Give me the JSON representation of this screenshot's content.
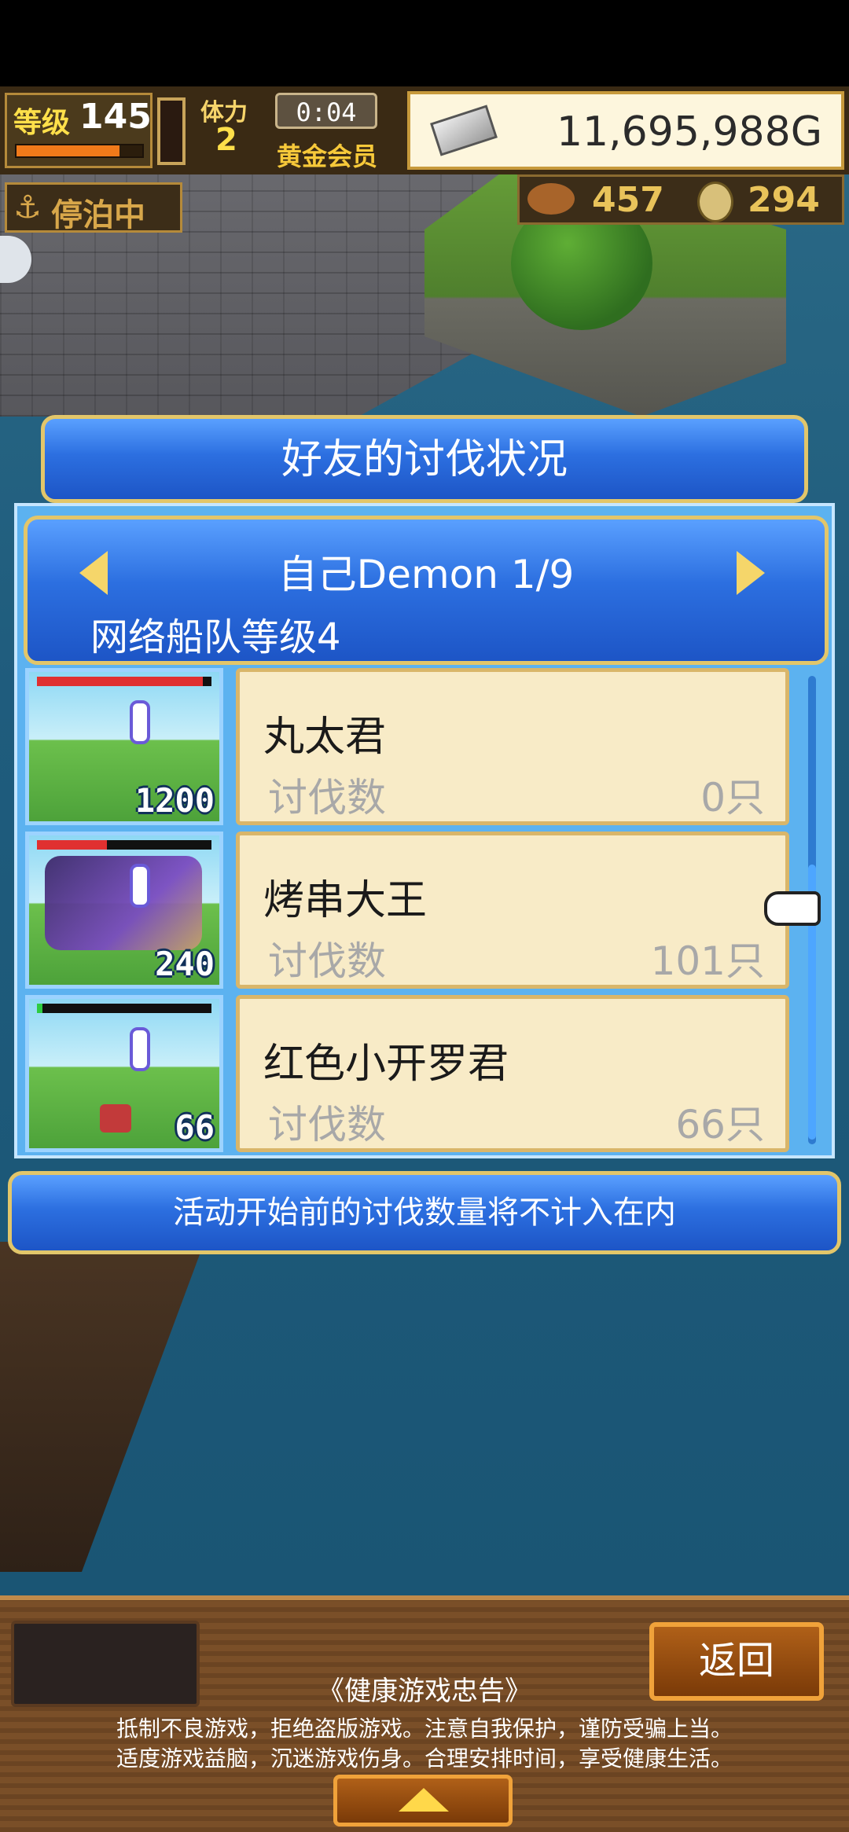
{
  "hud": {
    "level_label": "等级",
    "level_value": "145",
    "exp_progress": 0.82,
    "stamina_label": "体力",
    "stamina_value": "2",
    "timer": "0:04",
    "membership": "黄金会员",
    "money": "11,695,988G",
    "status": "停泊中",
    "meat": "457",
    "coins": "294"
  },
  "dialog": {
    "title": "好友的讨伐状况",
    "header_title": "自己Demon 1/9",
    "header_sub": "网络船队等级4",
    "rows": [
      {
        "name": "丸太君",
        "label": "讨伐数",
        "count": "0只",
        "thumb_num": "1200",
        "hp": 0.95,
        "hp_color": "#e03030"
      },
      {
        "name": "烤串大王",
        "label": "讨伐数",
        "count": "101只",
        "thumb_num": "240",
        "hp": 0.4,
        "hp_color": "#e03030"
      },
      {
        "name": "红色小开罗君",
        "label": "讨伐数",
        "count": "66只",
        "thumb_num": "66",
        "hp": 0.03,
        "hp_color": "#2ecc40"
      }
    ],
    "note": "活动开始前的讨伐数量将不计入在内"
  },
  "bottom": {
    "back_label": "返回",
    "notice_title": "《健康游戏忠告》",
    "notice_line1": "抵制不良游戏，拒绝盗版游戏。注意自我保护，谨防受骗上当。",
    "notice_line2": "适度游戏益脑，沉迷游戏伤身。合理安排时间，享受健康生活。"
  },
  "icons": {
    "anchor": "anchor-icon",
    "money": "silver-bar-icon",
    "meat": "meat-icon",
    "coin": "coin-icon",
    "prev": "left-arrow-icon",
    "next": "right-arrow-icon",
    "cursor": "hand-pointer-icon",
    "expand": "up-arrow-icon"
  }
}
